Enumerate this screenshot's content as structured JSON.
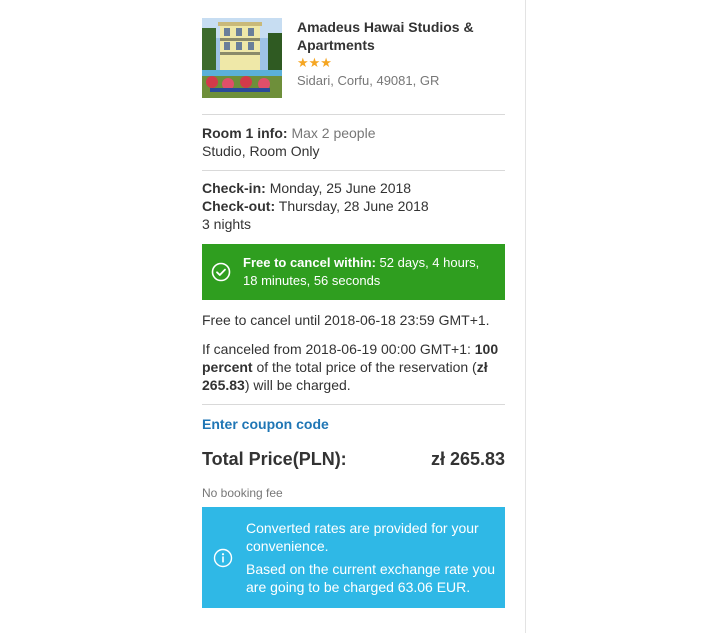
{
  "hotel": {
    "name": "Amadeus Hawai Studios & Apartments",
    "stars": "★★★",
    "address": "Sidari, Corfu, 49081, GR"
  },
  "room": {
    "label": "Room 1 info:",
    "capacity": "Max 2 people",
    "type": "Studio, Room Only"
  },
  "stay": {
    "checkin_label": "Check-in:",
    "checkin_date": "Monday, 25 June 2018",
    "checkout_label": "Check-out:",
    "checkout_date": "Thursday, 28 June 2018",
    "nights": "3 nights"
  },
  "cancellation": {
    "free_label": "Free to cancel within:",
    "free_time": "52 days, 4 hours, 18 minutes, 56 seconds",
    "free_until": "Free to cancel until 2018-06-18 23:59 GMT+1.",
    "penalty_prefix": "If canceled from 2018-06-19 00:00 GMT+1:",
    "penalty_percent": "100 percent",
    "penalty_mid": "of the total price of the reservation",
    "penalty_amount": "zł 265.83",
    "penalty_suffix": "will be charged."
  },
  "coupon": {
    "label": "Enter coupon code"
  },
  "total": {
    "label": "Total Price(PLN):",
    "amount": "zł 265.83",
    "fee_note": "No booking fee"
  },
  "notice": {
    "line1": "Converted rates are provided for your convenience.",
    "line2": "Based on the current exchange rate you are going to be charged 63.06 EUR."
  },
  "colors": {
    "cancel_green": "#2f9e1f",
    "info_blue": "#2fb8e6",
    "link_blue": "#1f76b5",
    "star_orange": "#f5a623"
  }
}
